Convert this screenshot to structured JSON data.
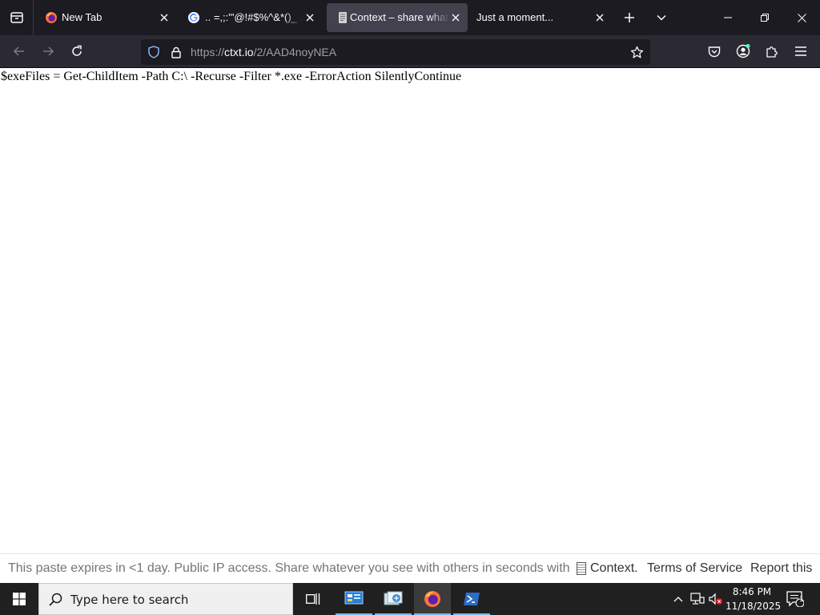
{
  "browser": {
    "tabs": [
      {
        "title": "New Tab",
        "icon": "firefox-icon",
        "active": false
      },
      {
        "title": ".. =,;:'\"@!#$%^&*()_ .. ..",
        "icon": "google-icon",
        "active": false
      },
      {
        "title": "Context – share whatever you see",
        "icon": "document-icon",
        "active": true
      },
      {
        "title": "Just a moment...",
        "icon": "",
        "active": false
      }
    ],
    "url_prefix": "https://",
    "url_host": "ctxt.io",
    "url_path": "/2/AAD4noyNEA",
    "colors": {
      "tabbar": "#1c1b22",
      "navbar": "#2b2a33",
      "active_tab": "#42414d",
      "urlbar": "#1c1b22"
    }
  },
  "page": {
    "paste_text": "$exeFiles = Get-ChildItem -Path C:\\ -Recurse -Filter *.exe -ErrorAction SilentlyContinue",
    "footer": {
      "notice": "This paste expires in <1 day. Public IP access. Share whatever you see with others in seconds with",
      "brand": "Context.",
      "terms": "Terms of Service",
      "report": "Report this"
    }
  },
  "taskbar": {
    "search_placeholder": "Type here to search",
    "apps": [
      "task-view-icon",
      "control-panel-icon",
      "photos-icon",
      "firefox-icon",
      "powershell-icon"
    ],
    "time": "8:46 PM",
    "date": "11/18/2025",
    "notification_count": "1",
    "colors": {
      "background": "#202020",
      "accent": "#76b9ed"
    }
  }
}
